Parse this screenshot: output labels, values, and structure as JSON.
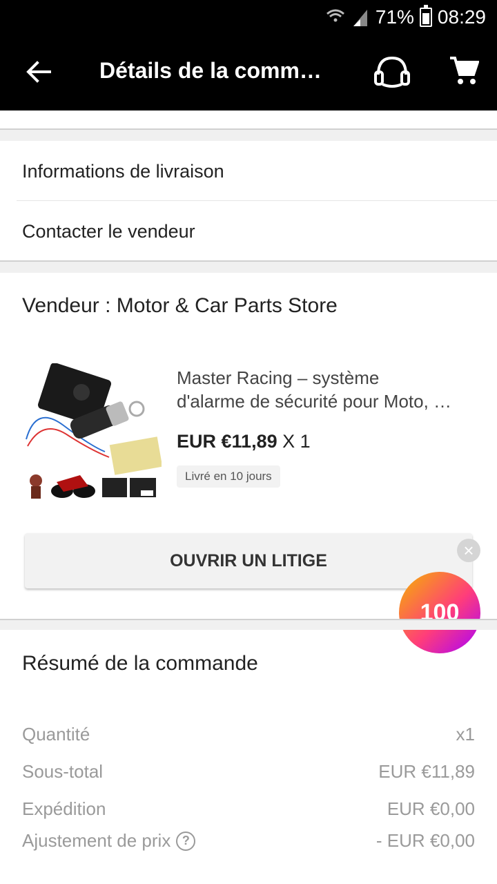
{
  "status_bar": {
    "battery": "71%",
    "time": "08:29"
  },
  "app_bar": {
    "title": "Détails de la comm…"
  },
  "links": {
    "delivery_info": "Informations de livraison",
    "contact_seller": "Contacter le vendeur"
  },
  "vendor": {
    "label": "Vendeur : Motor & Car Parts Store"
  },
  "product": {
    "title_line1": "Master Racing – système",
    "title_line2": "d'alarme de sécurité pour Moto, …",
    "price": "EUR €11,89",
    "quantity": "X 1",
    "delivery": "Livré en 10 jours"
  },
  "actions": {
    "open_dispute": "OUVRIR UN LITIGE"
  },
  "coin": {
    "value": "100",
    "close": "×"
  },
  "summary": {
    "title": "Résumé de la commande",
    "rows": [
      {
        "label": "Quantité",
        "value": "x1"
      },
      {
        "label": "Sous-total",
        "value": "EUR €11,89"
      },
      {
        "label": "Expédition",
        "value": "EUR €0,00"
      },
      {
        "label": "Ajustement de prix",
        "value": "- EUR €0,00"
      }
    ],
    "help": "?"
  }
}
